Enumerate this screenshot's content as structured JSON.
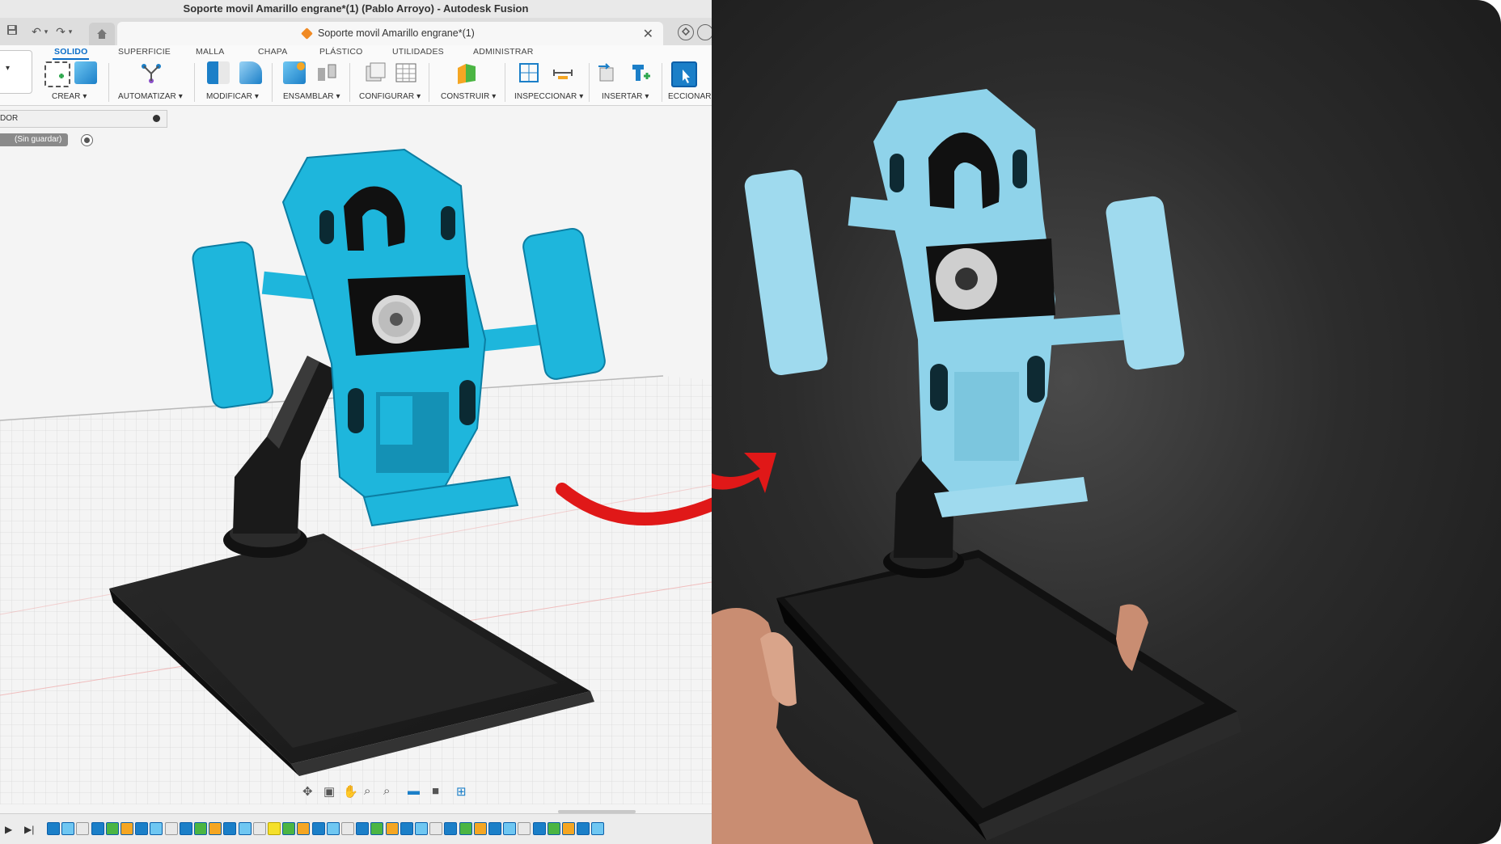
{
  "window": {
    "title": "Soporte movil Amarillo engrane*(1) (Pablo Arroyo) - Autodesk Fusion"
  },
  "document_tab": {
    "name": "Soporte movil Amarillo engrane*(1)",
    "close": "✕"
  },
  "ribbon": {
    "tabs": [
      {
        "label": "SOLIDO",
        "active": true
      },
      {
        "label": "SUPERFICIE",
        "active": false
      },
      {
        "label": "MALLA",
        "active": false
      },
      {
        "label": "CHAPA",
        "active": false
      },
      {
        "label": "PLÁSTICO",
        "active": false
      },
      {
        "label": "UTILIDADES",
        "active": false
      },
      {
        "label": "ADMINISTRAR",
        "active": false
      }
    ],
    "groups": [
      {
        "label": "CREAR ▾"
      },
      {
        "label": "AUTOMATIZAR ▾"
      },
      {
        "label": "MODIFICAR ▾"
      },
      {
        "label": "ENSAMBLAR ▾"
      },
      {
        "label": "CONFIGURAR ▾"
      },
      {
        "label": "CONSTRUIR ▾"
      },
      {
        "label": "INSPECCIONAR ▾"
      },
      {
        "label": "INSERTAR ▾"
      },
      {
        "label": "ECCIONAR"
      }
    ],
    "left_dropdown": "▾"
  },
  "browser": {
    "label": "DOR",
    "unsaved": "(Sin guardar)"
  },
  "colors": {
    "accent": "#0a6ec9",
    "model_blue": "#1eb6dc",
    "printed_blue": "#8fd3ea",
    "arrow_red": "#e01818",
    "base_black": "#1c1c1c"
  },
  "icons": {
    "save": "save-icon",
    "undo": "undo-icon",
    "redo": "redo-icon",
    "home": "home-icon",
    "nav": [
      "orbit-icon",
      "look-at-icon",
      "pan-icon",
      "zoom-icon",
      "zoom-window-icon",
      "display-settings-icon",
      "visual-style-icon",
      "viewports-icon"
    ],
    "timeline_controls": [
      "play-icon",
      "go-to-end-icon"
    ]
  },
  "timeline": {
    "feature_count": 38
  }
}
